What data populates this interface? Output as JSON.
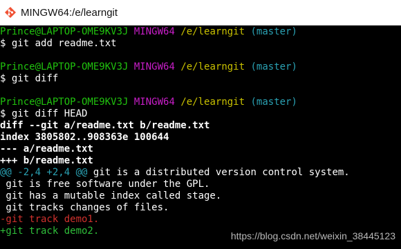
{
  "window": {
    "title": "MINGW64:/e/learngit",
    "icon": "git-bash-icon"
  },
  "prompt": {
    "user_host": "Prince@LAPTOP-OME9KV3J",
    "shell": "MINGW64",
    "path": "/e/learngit",
    "branch": "(master)",
    "symbol": "$"
  },
  "commands": [
    "git add readme.txt",
    "git diff",
    "git diff HEAD"
  ],
  "diff": {
    "header": "diff --git a/readme.txt b/readme.txt",
    "index": "index 3805802..908363e 100644",
    "old_file": "--- a/readme.txt",
    "new_file": "+++ b/readme.txt",
    "hunk_range": "@@ -2,4 +2,4 @@",
    "hunk_context": " git is a distributed version control system.",
    "context_lines": [
      " git is free software under the GPL.",
      " git has a mutable index called stage.",
      " git tracks changes of files."
    ],
    "removed": "-git track demo1.",
    "added": "+git track demo2."
  },
  "watermark": "https://blog.csdn.net/weixin_38445123",
  "colors": {
    "prompt_user": "#20c20e",
    "prompt_shell": "#c81ec8",
    "prompt_path": "#c8c000",
    "prompt_branch": "#2aa1b3",
    "removed": "#d0312d",
    "added": "#2fbf3a"
  }
}
